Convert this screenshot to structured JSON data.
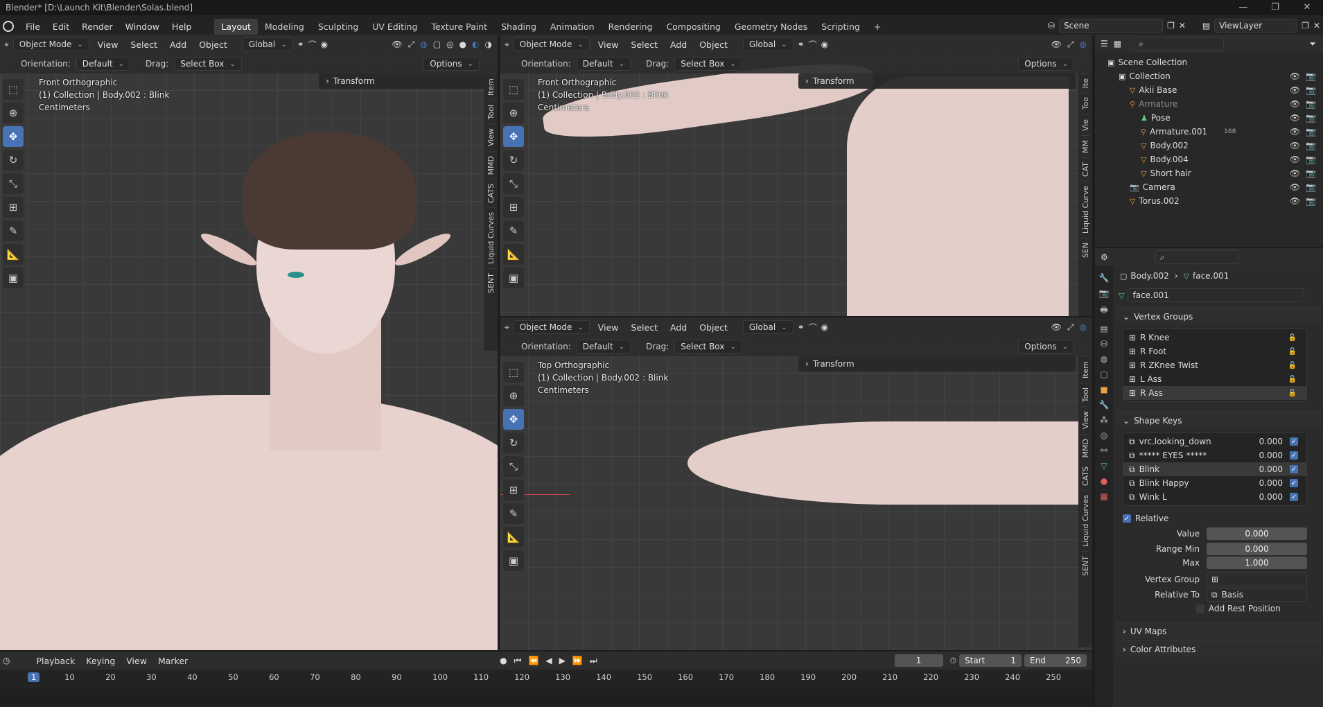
{
  "window": {
    "title": "Blender* [D:\\Launch Kit\\Blender\\Solas.blend]"
  },
  "menu": [
    "File",
    "Edit",
    "Render",
    "Window",
    "Help"
  ],
  "workspaces": [
    "Layout",
    "Modeling",
    "Sculpting",
    "UV Editing",
    "Texture Paint",
    "Shading",
    "Animation",
    "Rendering",
    "Compositing",
    "Geometry Nodes",
    "Scripting"
  ],
  "active_workspace": "Layout",
  "scene": "Scene",
  "view_layer": "ViewLayer",
  "viewport_header": {
    "mode": "Object Mode",
    "menus": [
      "View",
      "Select",
      "Add",
      "Object"
    ],
    "transform_orientation": "Global",
    "orientation_label": "Orientation:",
    "orientation_value": "Default",
    "drag_label": "Drag:",
    "drag_value": "Select Box",
    "options": "Options"
  },
  "viewports": {
    "main": {
      "view": "Front Orthographic",
      "collection": "(1) Collection | Body.002 : Blink",
      "units": "Centimeters"
    },
    "top_right": {
      "view": "Front Orthographic",
      "collection": "(1) Collection | Body.002 : Blink",
      "units": "Centimeters"
    },
    "bottom_right": {
      "view": "Top Orthographic",
      "collection": "(1) Collection | Body.002 : Blink",
      "units": "Centimeters"
    }
  },
  "transform_panel": "Transform",
  "side_tabs": [
    "Item",
    "Tool",
    "View",
    "MMD",
    "CATS",
    "Liquid Curves",
    "SENT"
  ],
  "side_tabs_short": [
    "Ite",
    "Too",
    "Vie",
    "MM",
    "CAT",
    "Liquid Curve",
    "SEN"
  ],
  "outliner": {
    "root": "Scene Collection",
    "items": [
      {
        "name": "Collection",
        "indent": 1,
        "icon": "collection-icon"
      },
      {
        "name": "Akii Base",
        "indent": 2,
        "icon": "mesh-icon"
      },
      {
        "name": "Armature",
        "indent": 2,
        "icon": "armature-icon",
        "dim": true
      },
      {
        "name": "Pose",
        "indent": 3,
        "icon": "pose-icon"
      },
      {
        "name": "Armature.001",
        "indent": 3,
        "icon": "armature-icon",
        "badge": "168"
      },
      {
        "name": "Body.002",
        "indent": 3,
        "icon": "mesh-icon"
      },
      {
        "name": "Body.004",
        "indent": 3,
        "icon": "mesh-icon"
      },
      {
        "name": "Short hair",
        "indent": 3,
        "icon": "mesh-icon"
      },
      {
        "name": "Camera",
        "indent": 2,
        "icon": "camera-icon"
      },
      {
        "name": "Torus.002",
        "indent": 2,
        "icon": "mesh-icon"
      }
    ]
  },
  "properties": {
    "breadcrumb_object": "Body.002",
    "breadcrumb_data": "face.001",
    "data_name": "face.001",
    "vertex_groups_title": "Vertex Groups",
    "vertex_groups": [
      "R Knee",
      "R Foot",
      "R ZKnee Twist",
      "L Ass",
      "R Ass"
    ],
    "selected_vertex_group": "R Ass",
    "shape_keys_title": "Shape Keys",
    "shape_keys": [
      {
        "name": "vrc.looking_down",
        "value": "0.000"
      },
      {
        "name": "***** EYES *****",
        "value": "0.000"
      },
      {
        "name": "Blink",
        "value": "0.000"
      },
      {
        "name": "Blink Happy",
        "value": "0.000"
      },
      {
        "name": "Wink L",
        "value": "0.000"
      }
    ],
    "selected_shape_key": "Blink",
    "relative_label": "Relative",
    "value_label": "Value",
    "value": "0.000",
    "range_min_label": "Range Min",
    "range_min": "0.000",
    "max_label": "Max",
    "max": "1.000",
    "vertex_group_label": "Vertex Group",
    "relative_to_label": "Relative To",
    "relative_to": "Basis",
    "add_rest_position": "Add Rest Position",
    "uv_maps": "UV Maps",
    "color_attributes": "Color Attributes"
  },
  "timeline": {
    "menus": [
      "Playback",
      "Keying",
      "View",
      "Marker"
    ],
    "current_frame": "1",
    "start_label": "Start",
    "start": "1",
    "end_label": "End",
    "end": "250",
    "ticks": [
      "1",
      "10",
      "20",
      "30",
      "40",
      "50",
      "60",
      "70",
      "80",
      "90",
      "100",
      "110",
      "120",
      "130",
      "140",
      "150",
      "160",
      "170",
      "180",
      "190",
      "200",
      "210",
      "220",
      "230",
      "240",
      "250"
    ]
  },
  "colors": {
    "accent": "#4772b3",
    "bg": "#1d1d1d",
    "header": "#2d2d2d",
    "skin": "#e5cdc8",
    "hair": "#4a3a33"
  }
}
